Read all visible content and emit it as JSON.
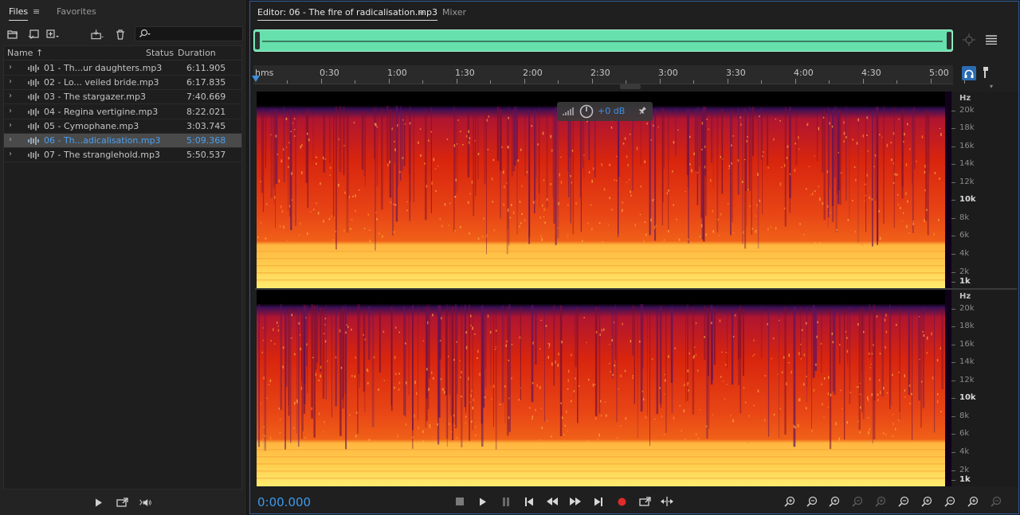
{
  "files_panel": {
    "tabs": [
      {
        "label": "Files"
      },
      {
        "label": "Favorites"
      }
    ],
    "menu_icon": "hamburger-menu-icon",
    "toolbar_icons": [
      "open-folder-icon",
      "import-icon",
      "new-file-icon",
      "insert-into-multitrack-icon",
      "trash-icon",
      "search-icon"
    ],
    "search": {
      "value": "",
      "placeholder": ""
    },
    "columns": {
      "name": "Name",
      "sort_indicator": "↑",
      "status": "Status",
      "duration": "Duration"
    },
    "files": [
      {
        "name": "01 - Th...ur daughters.mp3",
        "duration": "6:11.905",
        "selected": false
      },
      {
        "name": "02 - Lo... veiled bride.mp3",
        "duration": "6:17.835",
        "selected": false
      },
      {
        "name": "03 - The stargazer.mp3",
        "duration": "7:40.669",
        "selected": false
      },
      {
        "name": "04 - Regina vertigine.mp3",
        "duration": "8:22.021",
        "selected": false
      },
      {
        "name": "05 - Cymophane.mp3",
        "duration": "3:03.745",
        "selected": false
      },
      {
        "name": "06 - Th...adicalisation.mp3",
        "duration": "5:09.368",
        "selected": true
      },
      {
        "name": "07 - The stranglehold.mp3",
        "duration": "5:50.537",
        "selected": false
      }
    ],
    "preview_controls": [
      "play-icon",
      "loop-icon",
      "autoplay-icon"
    ]
  },
  "editor": {
    "tabs": [
      {
        "label": "Editor: 06 - The fire of radicalisation.mp3",
        "active": true
      },
      {
        "label": "Mixer",
        "active": false
      }
    ],
    "timeline": {
      "labels": [
        "hms",
        "0:30",
        "1:00",
        "1:30",
        "2:00",
        "2:30",
        "3:00",
        "3:30",
        "4:00",
        "4:30",
        "5:00"
      ]
    },
    "hud": {
      "gain": "+0 dB"
    },
    "hz_scale": {
      "unit": "Hz",
      "labels": [
        "20k",
        "18k",
        "16k",
        "14k",
        "12k",
        "10k",
        "8k",
        "6k",
        "4k",
        "2k",
        "1k"
      ]
    },
    "transport": {
      "time": "0:00.000",
      "buttons": [
        "stop-icon",
        "play-icon",
        "pause-icon",
        "go-to-start-icon",
        "rewind-icon",
        "fast-forward-icon",
        "go-to-end-icon",
        "record-icon",
        "loop-icon",
        "skip-selection-icon"
      ],
      "zoom_buttons": [
        "zoom-in-amplitude-icon",
        "zoom-out-amplitude-icon",
        "zoom-in-time-icon",
        "zoom-out-time-icon",
        "zoom-out-full-icon",
        "zoom-in-left-icon",
        "zoom-in-right-icon",
        "zoom-selection-icon",
        "zoom-reset-icon",
        "zoom-frequency-icon"
      ]
    },
    "colors": {
      "accent": "#3d9bef",
      "overview_waveform": "#66e0ad",
      "record": "#e02b2b",
      "spectrum_low": "#2a0a35",
      "spectrum_mid": "#d82a10",
      "spectrum_high": "#ffe06a"
    }
  }
}
